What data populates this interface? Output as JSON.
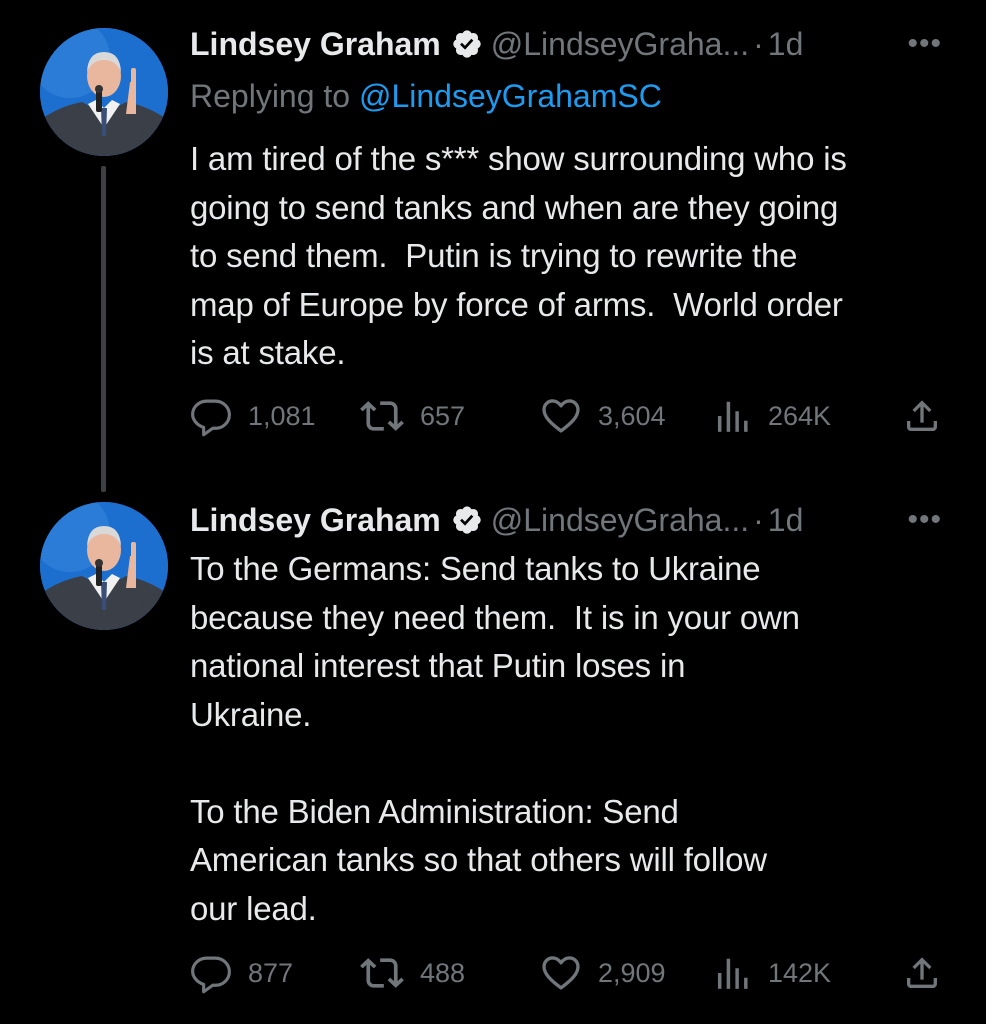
{
  "tweets": [
    {
      "author_name": "Lindsey Graham",
      "handle": "@LindseyGraha...",
      "separator": "·",
      "time": "1d",
      "more": "•••",
      "replying_prefix": "Replying to ",
      "replying_to": "@LindseyGrahamSC",
      "text": "I am tired of the s*** show surrounding who is\ngoing to send tanks and when are they going\nto send them.  Putin is trying to rewrite the\nmap of Europe by force of arms.  World order\nis at stake.",
      "replies": "1,081",
      "retweets": "657",
      "likes": "3,604",
      "views": "264K"
    },
    {
      "author_name": "Lindsey Graham",
      "handle": "@LindseyGraha...",
      "separator": "·",
      "time": "1d",
      "more": "•••",
      "text": "To the Germans: Send tanks to Ukraine\nbecause they need them.  It is in your own\nnational interest that Putin loses in\nUkraine.\n\nTo the Biden Administration: Send\nAmerican tanks so that others will follow\nour lead.",
      "replies": "877",
      "retweets": "488",
      "likes": "2,909",
      "views": "142K"
    }
  ],
  "colors": {
    "background": "#000000",
    "primary_text": "#e7e9ea",
    "secondary_text": "#71767b",
    "link": "#1d9bf0",
    "thread_line": "#3e4144"
  },
  "icons": [
    "verified-badge-icon",
    "reply-icon",
    "retweet-icon",
    "like-icon",
    "views-icon",
    "share-icon",
    "more-icon"
  ]
}
